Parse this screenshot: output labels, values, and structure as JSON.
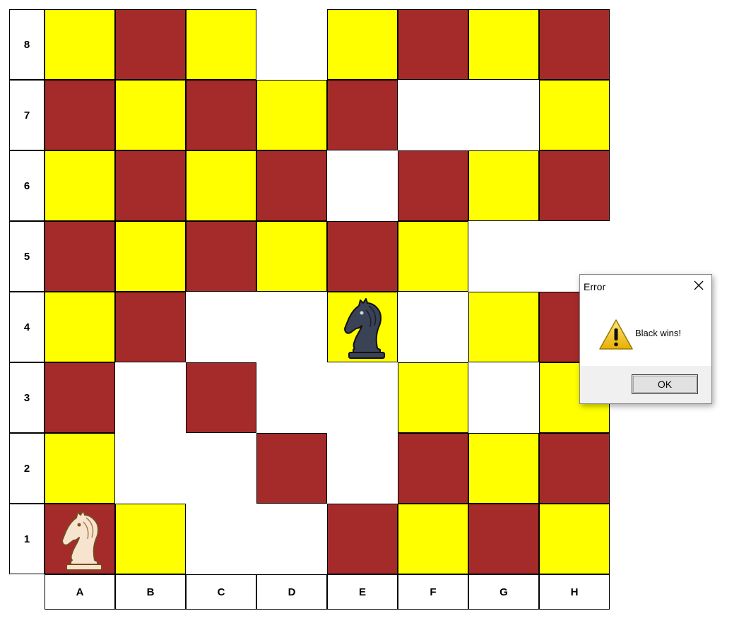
{
  "board": {
    "rank_labels": [
      "8",
      "7",
      "6",
      "5",
      "4",
      "3",
      "2",
      "1"
    ],
    "file_labels": [
      "A",
      "B",
      "C",
      "D",
      "E",
      "F",
      "G",
      "H"
    ],
    "rows": [
      [
        "yellow",
        "red",
        "yellow",
        "empty",
        "yellow",
        "red",
        "yellow",
        "red"
      ],
      [
        "red",
        "yellow",
        "red",
        "yellow",
        "red",
        "empty",
        "empty",
        "yellow"
      ],
      [
        "yellow",
        "red",
        "yellow",
        "red",
        "empty",
        "red",
        "yellow",
        "red"
      ],
      [
        "red",
        "yellow",
        "red",
        "yellow",
        "red",
        "yellow",
        "empty",
        "empty"
      ],
      [
        "yellow",
        "red",
        "empty",
        "empty",
        "yellow",
        "empty",
        "yellow",
        "red"
      ],
      [
        "red",
        "empty",
        "red",
        "empty",
        "empty",
        "yellow",
        "empty",
        "yellow"
      ],
      [
        "yellow",
        "empty",
        "empty",
        "red",
        "empty",
        "red",
        "yellow",
        "red"
      ],
      [
        "red",
        "yellow",
        "empty",
        "empty",
        "red",
        "yellow",
        "red",
        "yellow"
      ]
    ],
    "colors": {
      "yellow": "#ffff00",
      "red": "#a52a2a",
      "empty": "#ffffff"
    },
    "pieces": [
      {
        "type": "knight",
        "color": "white",
        "square": "A1",
        "icon": "white-knight-icon"
      },
      {
        "type": "knight",
        "color": "black",
        "square": "E4",
        "icon": "black-knight-icon"
      }
    ]
  },
  "dialog": {
    "title": "Error",
    "message": "Black wins!",
    "ok_label": "OK",
    "icon": "warning-icon",
    "close_icon": "close-icon"
  }
}
